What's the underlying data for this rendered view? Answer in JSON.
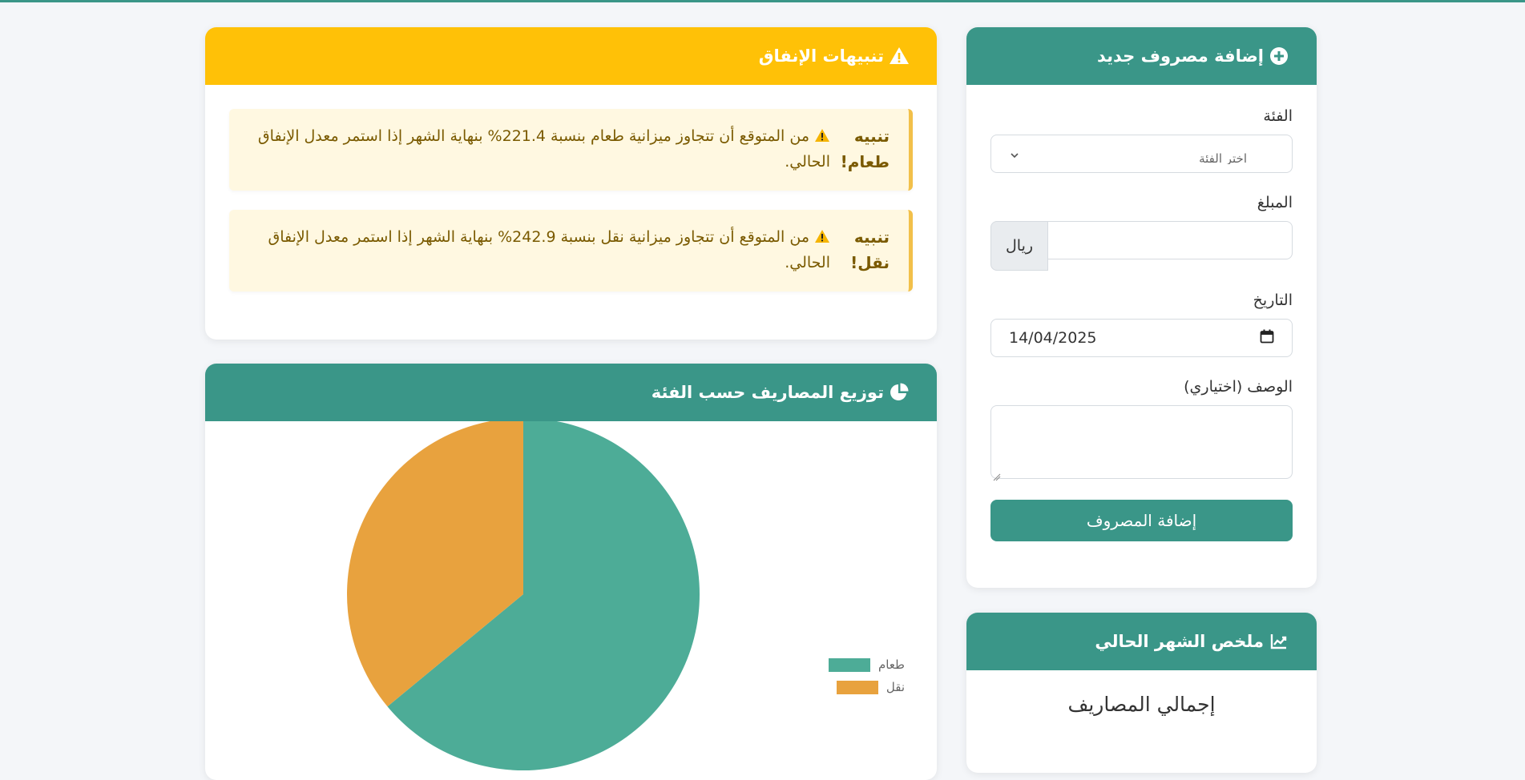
{
  "form": {
    "title": "إضافة مصروف جديد",
    "category_label": "الفئة",
    "category_placeholder": "اختر الفئة",
    "amount_label": "المبلغ",
    "amount_value": "",
    "currency": "ريال",
    "date_label": "التاريخ",
    "date_value": "14/04/2025",
    "description_label": "الوصف (اختياري)",
    "description_value": "",
    "submit_label": "إضافة المصروف"
  },
  "summary": {
    "title": "ملخص الشهر الحالي",
    "total_label": "إجمالي المصاريف"
  },
  "alerts": {
    "title": "تنبيهات الإنفاق",
    "items": [
      {
        "title": "تنبيه طعام!",
        "text": "من المتوقع أن تتجاوز ميزانية طعام بنسبة 221.4% بنهاية الشهر إذا استمر معدل الإنفاق الحالي."
      },
      {
        "title": "تنبيه نقل!",
        "text": "من المتوقع أن تتجاوز ميزانية نقل بنسبة 242.9% بنهاية الشهر إذا استمر معدل الإنفاق الحالي."
      }
    ]
  },
  "pie": {
    "title": "توزيع المصاريف حسب الفئة"
  },
  "chart_data": {
    "type": "pie",
    "categories": [
      "طعام",
      "نقل"
    ],
    "values": [
      64,
      36
    ],
    "colors": [
      "#4dac97",
      "#e8a23e"
    ],
    "legend": "right"
  },
  "colors": {
    "primary": "#3a9688",
    "warning": "#ffc107",
    "alert_bg": "#fff8e1",
    "alert_text": "#7a5a00"
  }
}
